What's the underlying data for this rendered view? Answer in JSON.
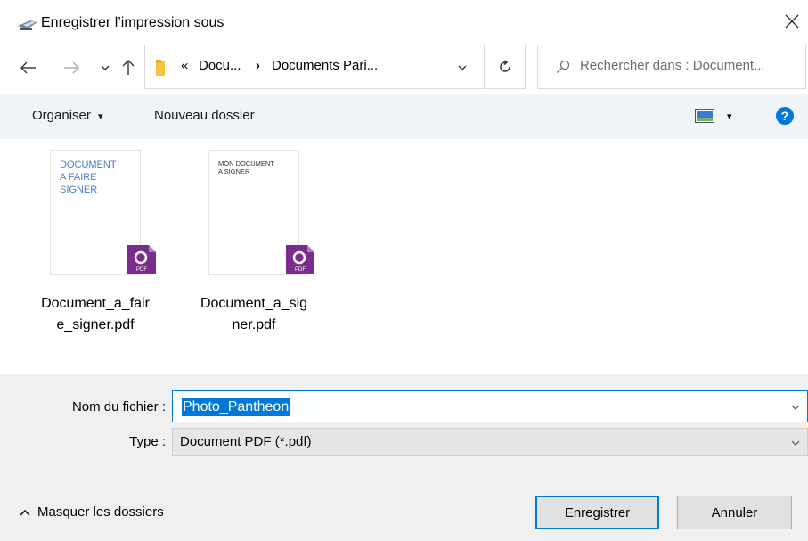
{
  "window": {
    "title": "Enregistrer l’impression sous",
    "close_icon": "close-icon"
  },
  "nav": {
    "back_icon": "arrow-left-icon",
    "forward_icon": "arrow-right-icon",
    "recent_icon": "chevron-down-icon",
    "up_icon": "arrow-up-icon",
    "breadcrumb_overflow": "«",
    "crumb_1": "Docu...",
    "crumb_separator": "›",
    "crumb_2": "Documents Pari...",
    "refresh_icon": "refresh-icon",
    "search_placeholder": "Rechercher dans : Document..."
  },
  "toolbar": {
    "organize_label": "Organiser",
    "organize_caret": "▾",
    "new_folder_label": "Nouveau dossier",
    "view_icon": "view-options-icon",
    "view_caret": "▾",
    "help_label": "?"
  },
  "files": [
    {
      "thumb_text": [
        "DOCUMENT",
        "A FAIRE",
        "SIGNER"
      ],
      "name_line1": "Document_a_fair",
      "name_line2": "e_signer.pdf",
      "badge_label": "PDF"
    },
    {
      "thumb_text": [
        "MON DOCUMENT",
        "A SIGNER"
      ],
      "name_line1": "Document_a_sig",
      "name_line2": "ner.pdf",
      "badge_label": "PDF"
    }
  ],
  "form": {
    "filename_label": "Nom du fichier :",
    "filename_value": "Photo_Pantheon",
    "type_label": "Type :",
    "type_value": "Document PDF (*.pdf)"
  },
  "footer": {
    "hide_folders_label": "Masquer les dossiers",
    "save_label": "Enregistrer",
    "cancel_label": "Annuler"
  },
  "colors": {
    "accent": "#0078d7",
    "toolbar_bg": "#f0f4f9",
    "footer_bg": "#f0f0f0",
    "pdf_badge": "#7b2d8e",
    "thumb_text_blue": "#4a7ec2"
  }
}
